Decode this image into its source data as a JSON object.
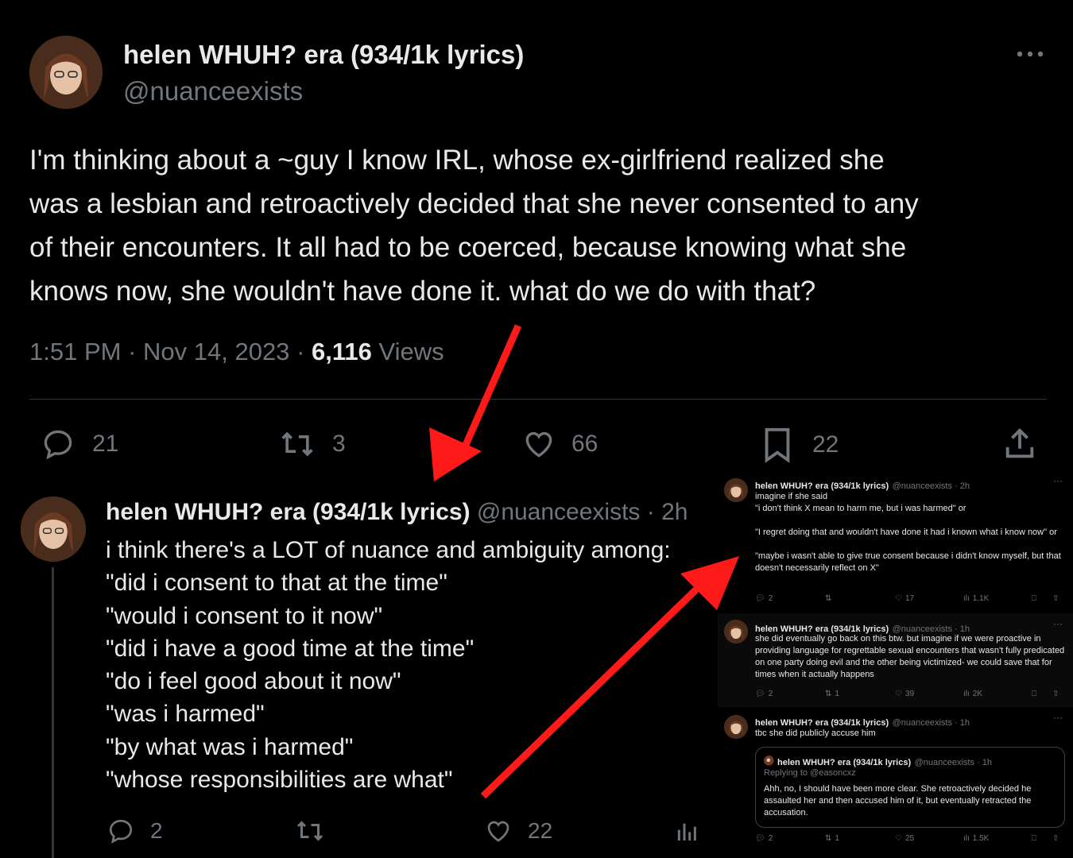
{
  "main_tweet": {
    "display_name": "helen WHUH? era (934/1k lyrics)",
    "handle": "@nuanceexists",
    "text_lines": [
      "I'm thinking about a ~guy I know IRL, whose ex-girlfriend realized she",
      "was a lesbian and retroactively decided that she never consented to any",
      "of their encounters. It all had to be coerced, because knowing what she",
      "knows now, she wouldn't have done it. what do we do with that?"
    ],
    "time": "1:51 PM",
    "date": "Nov 14, 2023",
    "views_count": "6,116",
    "views_label": "Views",
    "replies": "21",
    "retweets": "3",
    "likes": "66",
    "bookmarks": "22"
  },
  "reply_tweet": {
    "display_name": "helen WHUH? era (934/1k lyrics)",
    "handle": "@nuanceexists",
    "age": "· 2h",
    "text_lines": [
      "i think there's a LOT of nuance and ambiguity among:",
      "\"did i consent to that at the time\"",
      "\"would i consent to it now\"",
      "\"did i have a good time at the time\"",
      "\"do i feel good about it now\"",
      "\"was i harmed\"",
      "\"by what was i harmed\"",
      "\"whose responsibilities are what\""
    ],
    "replies": "2",
    "likes": "22"
  },
  "side_tweets": [
    {
      "display_name": "helen WHUH? era (934/1k lyrics)",
      "handle": "@nuanceexists · 2h",
      "text": "imagine if she said\n\"i don't think X mean to harm me, but i was harmed\" or\n\n\"I regret doing that and wouldn't have done it had i known what i know now\" or\n\n\"maybe i wasn't able to give true consent because i didn't know myself, but that doesn't necessarily reflect on X\"",
      "replies": "2",
      "retweets": "",
      "likes": "17",
      "views": "1.1K"
    },
    {
      "display_name": "helen WHUH? era (934/1k lyrics)",
      "handle": "@nuanceexists · 1h",
      "text": "she did eventually go back on this btw. but imagine if we were proactive in providing language for regrettable sexual encounters that wasn't fully predicated on one party doing evil and the other being victimized- we could save that for times when it actually happens",
      "replies": "2",
      "retweets": "1",
      "likes": "39",
      "views": "2K"
    },
    {
      "display_name": "helen WHUH? era (934/1k lyrics)",
      "handle": "@nuanceexists · 1h",
      "text": "tbc she did publicly accuse him",
      "replies": "2",
      "retweets": "1",
      "likes": "25",
      "views": "1.5K",
      "quote": {
        "display_name": "helen WHUH? era (934/1k lyrics)",
        "handle": "@nuanceexists · 1h",
        "replying_to": "Replying to @easoncxz",
        "text": "Ahh, no, I should have been more clear. She retroactively decided he assaulted her and then accused him of it, but eventually retracted the accusation."
      }
    }
  ],
  "colors": {
    "background": "#000000",
    "text": "#e7e9ea",
    "muted": "#71767b",
    "arrow": "#ff1a1a"
  }
}
